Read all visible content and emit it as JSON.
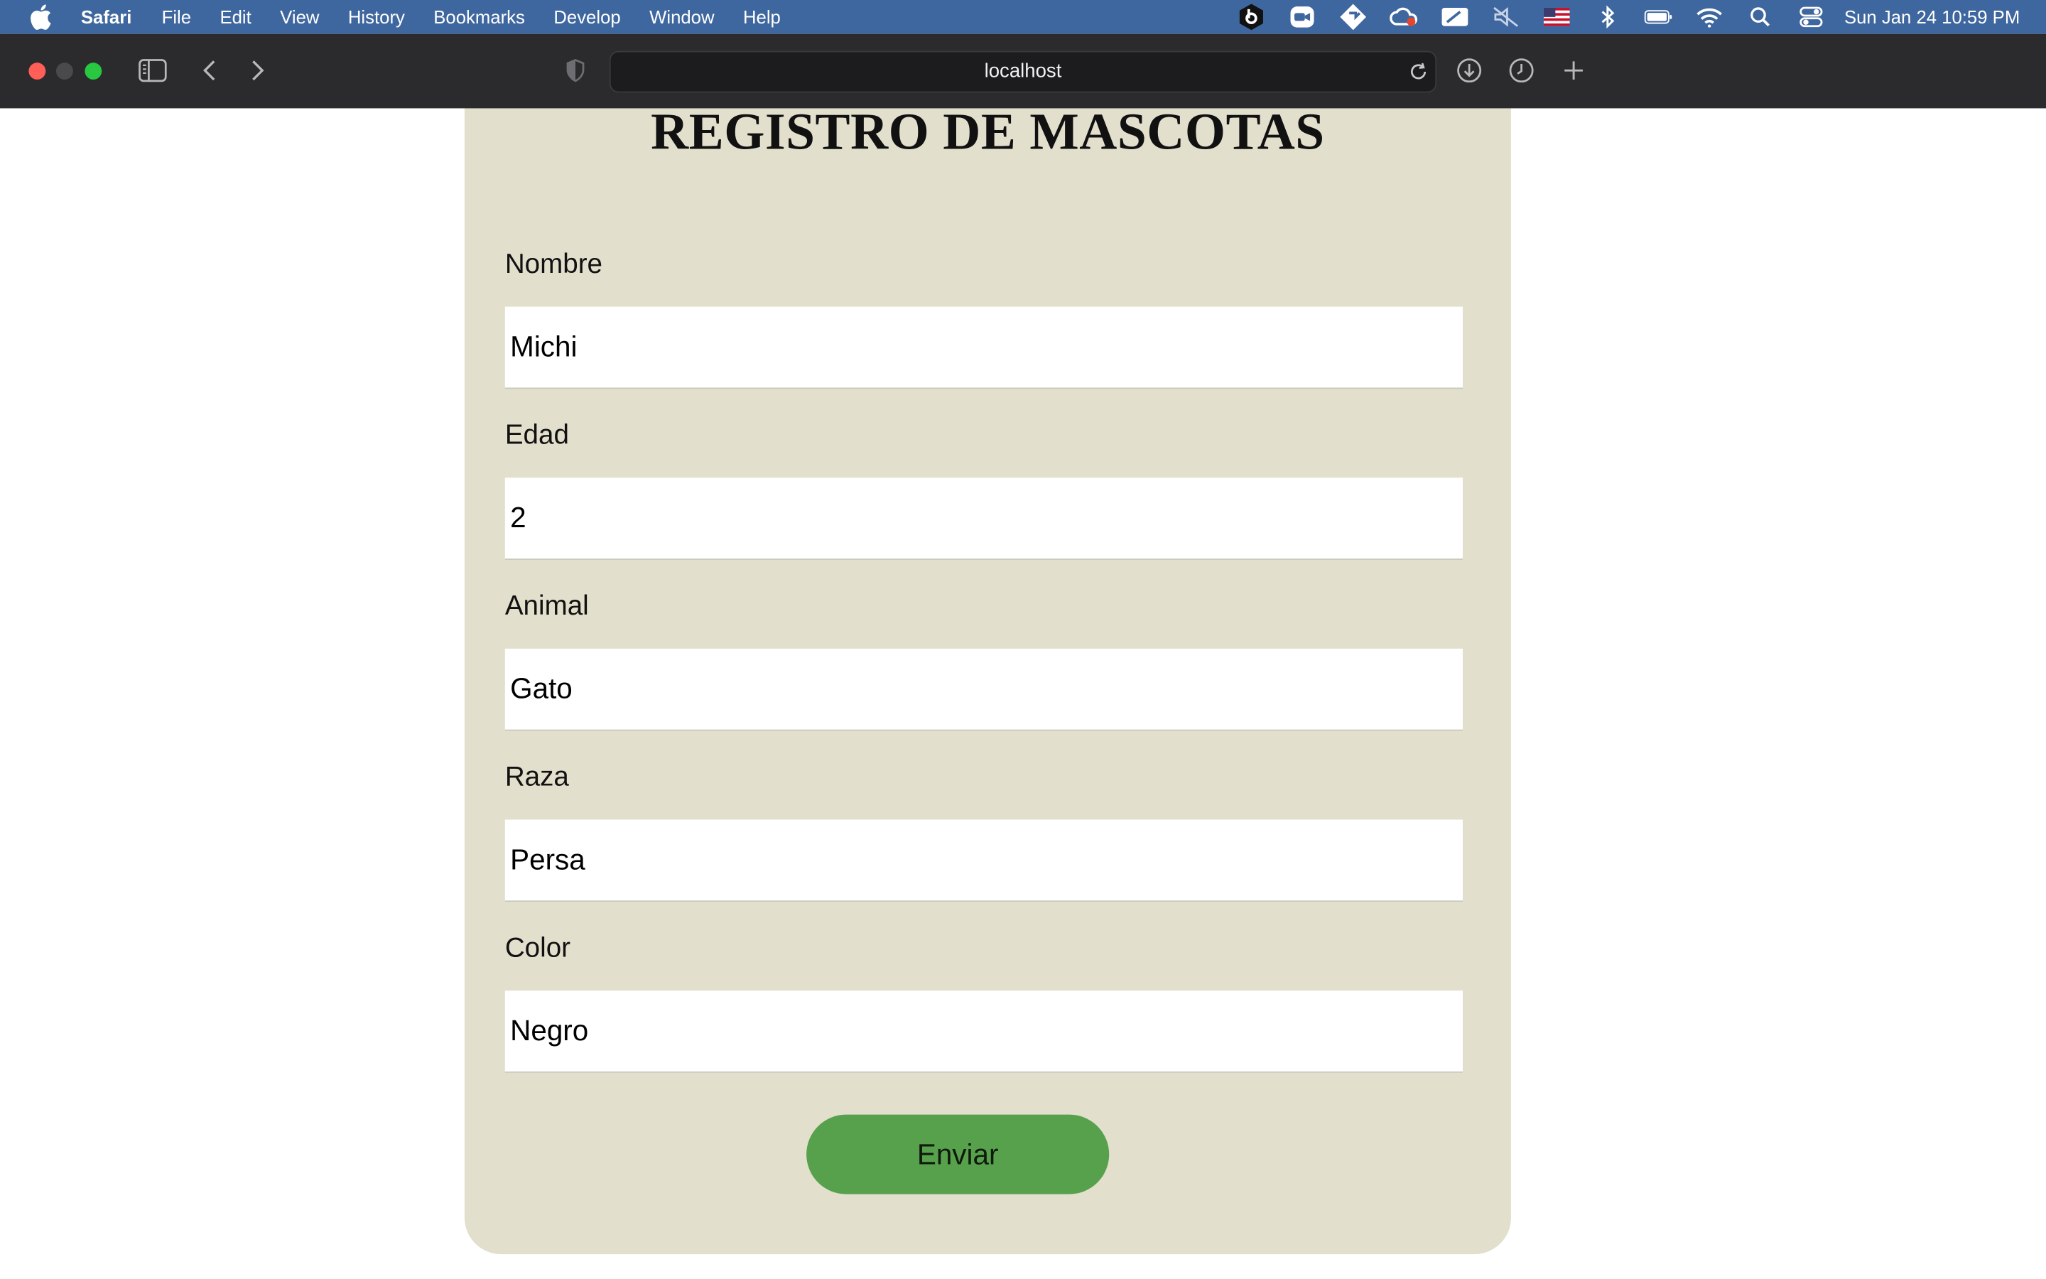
{
  "menubar": {
    "app_name": "Safari",
    "menus": [
      "File",
      "Edit",
      "View",
      "History",
      "Bookmarks",
      "Develop",
      "Window",
      "Help"
    ],
    "clock": "Sun Jan 24  10:59 PM",
    "status_icons": [
      "bitwarden-icon",
      "zoom-icon",
      "diamond-app-icon",
      "creative-cloud-icon",
      "airplay-icon",
      "mute-icon",
      "us-flag-icon",
      "bluetooth-icon",
      "battery-icon",
      "wifi-icon",
      "spotlight-icon",
      "control-center-icon"
    ]
  },
  "toolbar": {
    "url": "localhost",
    "colors": {
      "close": "#ff5f57",
      "minimize": "#4a4a4c",
      "zoom": "#28c840"
    }
  },
  "form": {
    "title": "REGISTRO DE MASCOTAS",
    "fields": [
      {
        "label": "Nombre",
        "value": "Michi"
      },
      {
        "label": "Edad",
        "value": "2"
      },
      {
        "label": "Animal",
        "value": "Gato"
      },
      {
        "label": "Raza",
        "value": "Persa"
      },
      {
        "label": "Color",
        "value": "Negro"
      }
    ],
    "submit_label": "Enviar",
    "colors": {
      "card_background": "#e3dfcd",
      "button": "#57a14d"
    }
  }
}
